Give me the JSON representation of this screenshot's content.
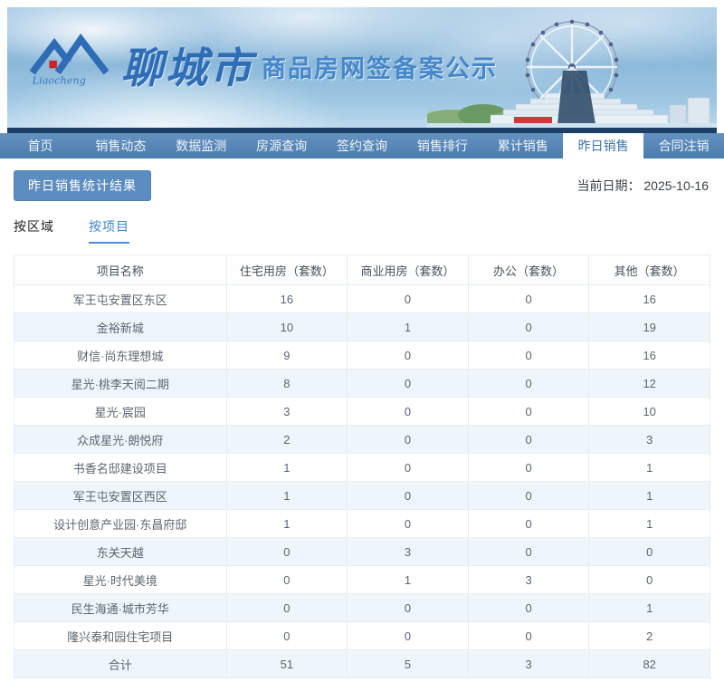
{
  "page_title": "聊城市商品房网签备案公示",
  "banner": {
    "logo_text": "Liaocheng",
    "title_city": "聊城市",
    "title_main": "商品房网签备案公示"
  },
  "nav": {
    "items": [
      {
        "label": "首页",
        "active": false
      },
      {
        "label": "销售动态",
        "active": false
      },
      {
        "label": "数据监测",
        "active": false
      },
      {
        "label": "房源查询",
        "active": false
      },
      {
        "label": "签约查询",
        "active": false
      },
      {
        "label": "销售排行",
        "active": false
      },
      {
        "label": "累计销售",
        "active": false
      },
      {
        "label": "昨日销售",
        "active": true
      },
      {
        "label": "合同注销",
        "active": false
      }
    ]
  },
  "toolbar": {
    "result_button_label": "昨日销售统计结果",
    "date_label": "当前日期：",
    "date_value": "2025-10-16"
  },
  "view_tabs": [
    {
      "label": "按区域",
      "active": false
    },
    {
      "label": "按项目",
      "active": true
    }
  ],
  "table": {
    "columns": [
      "项目名称",
      "住宅用房（套数）",
      "商业用房（套数）",
      "办公（套数）",
      "其他（套数）"
    ],
    "rows": [
      [
        "军王屯安置区东区",
        "16",
        "0",
        "0",
        "16"
      ],
      [
        "金裕新城",
        "10",
        "1",
        "0",
        "19"
      ],
      [
        "财信·尚东理想城",
        "9",
        "0",
        "0",
        "16"
      ],
      [
        "星光·桃李天阅二期",
        "8",
        "0",
        "0",
        "12"
      ],
      [
        "星光·宸园",
        "3",
        "0",
        "0",
        "10"
      ],
      [
        "众成星光·朗悦府",
        "2",
        "0",
        "0",
        "3"
      ],
      [
        "书香名邸建设项目",
        "1",
        "0",
        "0",
        "1"
      ],
      [
        "军王屯安置区西区",
        "1",
        "0",
        "0",
        "1"
      ],
      [
        "设计创意产业园·东昌府邸",
        "1",
        "0",
        "0",
        "1"
      ],
      [
        "东关天越",
        "0",
        "3",
        "0",
        "0"
      ],
      [
        "星光·时代美境",
        "0",
        "1",
        "3",
        "0"
      ],
      [
        "民生海通·城市芳华",
        "0",
        "0",
        "0",
        "1"
      ],
      [
        "隆兴泰和园住宅项目",
        "0",
        "0",
        "0",
        "2"
      ]
    ],
    "total_row": [
      "合计",
      "51",
      "5",
      "3",
      "82"
    ]
  },
  "colors": {
    "nav_blue": "#4d7fb0",
    "nav_dark_strip": "#1d3e66",
    "accent_blue": "#3d84d2",
    "button_blue": "#5b8dc0",
    "alt_row_bg": "#eef6fc",
    "table_border": "#e7edf1",
    "title_blue": "#2f6db6"
  }
}
